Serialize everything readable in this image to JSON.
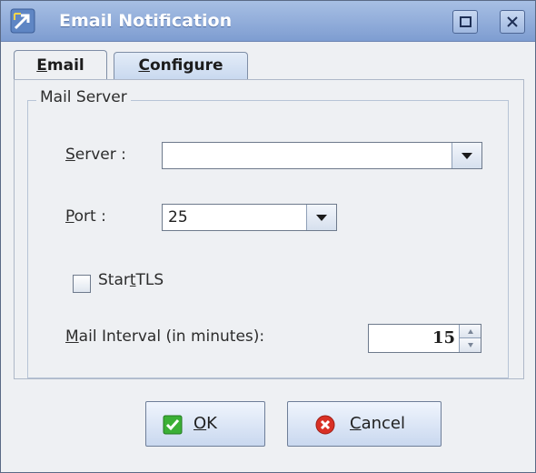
{
  "window": {
    "title": "Email Notification"
  },
  "tabs": [
    {
      "label_m": "E",
      "label_rest": "mail",
      "selected": false
    },
    {
      "label_m": "C",
      "label_rest": "onfigure",
      "selected": true
    }
  ],
  "mail_server": {
    "group_title": "Mail Server",
    "server_label_m": "S",
    "server_label_rest": "erver :",
    "server_value": "",
    "port_label_m": "P",
    "port_label_rest": "ort :",
    "port_value": "25",
    "starttls_label_pre": "Star",
    "starttls_label_m": "t",
    "starttls_label_rest": "TLS",
    "starttls_checked": false,
    "interval_label_m": "M",
    "interval_label_rest": "ail Interval (in minutes):",
    "interval_value": "15"
  },
  "buttons": {
    "ok_m": "O",
    "ok_rest": "K",
    "cancel_m": "C",
    "cancel_rest": "ancel"
  },
  "icons": {
    "app": "app-arrow-icon",
    "maximize": "maximize-icon",
    "close": "close-icon",
    "ok": "check-icon",
    "cancel": "cancel-icon",
    "dropdown": "dropdown-arrow-icon"
  },
  "colors": {
    "title_bar": "#8fabda",
    "ok_green": "#2fa12b",
    "cancel_red": "#d93025"
  }
}
